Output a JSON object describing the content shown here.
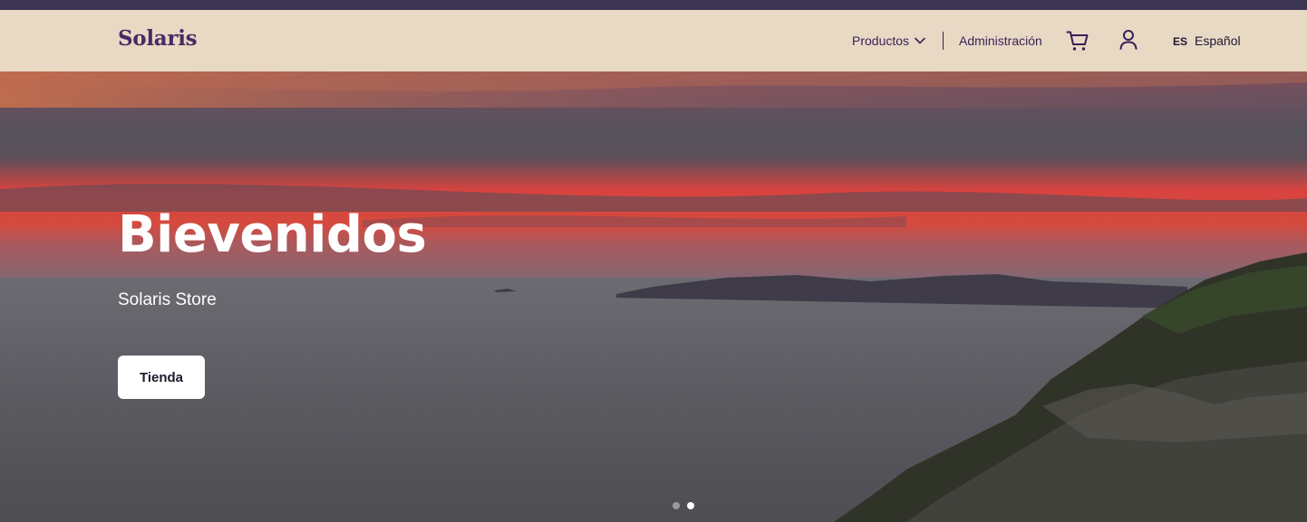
{
  "nav": {
    "brand": "Solaris",
    "products": "Productos",
    "admin": "Administración",
    "lang_code": "ES",
    "lang_label": "Español"
  },
  "icons": {
    "cart": "cart-icon",
    "user": "user-icon",
    "chevron": "chevron-down-icon"
  },
  "hero": {
    "title": "Bievenidos",
    "subtitle": "Solaris Store",
    "cta": "Tienda",
    "slide_count": 2,
    "active_slide": 2
  },
  "colors": {
    "topstrip": "#3c3552",
    "navbar": "#e8d9c5",
    "brand": "#4a2a63",
    "nav_text": "#3a1f57"
  }
}
